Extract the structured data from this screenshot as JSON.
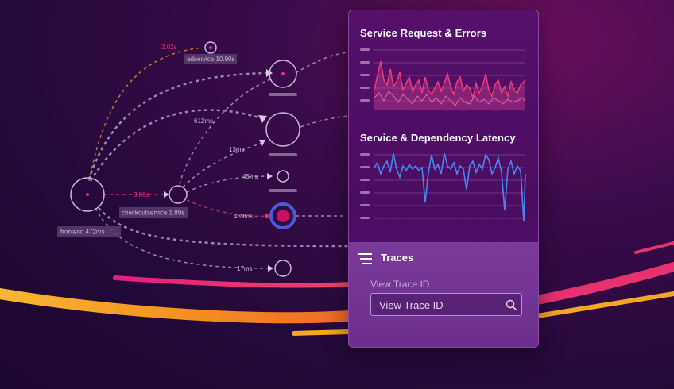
{
  "service_map": {
    "nodes": {
      "frontend": "frontend 472ms",
      "checkoutservice": "checkoutservice 1.89s",
      "adservice": "adservice 10.90s"
    },
    "edge_labels": {
      "to_adservice": "2.02s",
      "to_checkout": "3.89s",
      "e612": "612ms",
      "e13": "13ms",
      "e45": "45ms",
      "e439": "439ms",
      "e17": "17ms"
    }
  },
  "panel": {
    "request_errors_title": "Service  Request & Errors",
    "latency_title": "Service & Dependency Latency",
    "traces": {
      "title": "Traces",
      "field_label": "View Trace ID",
      "placeholder": "View Trace ID"
    }
  },
  "colors": {
    "accent_pink": "#e8326e",
    "accent_blue": "#4a86f0",
    "accent_orange": "#f5a623"
  }
}
